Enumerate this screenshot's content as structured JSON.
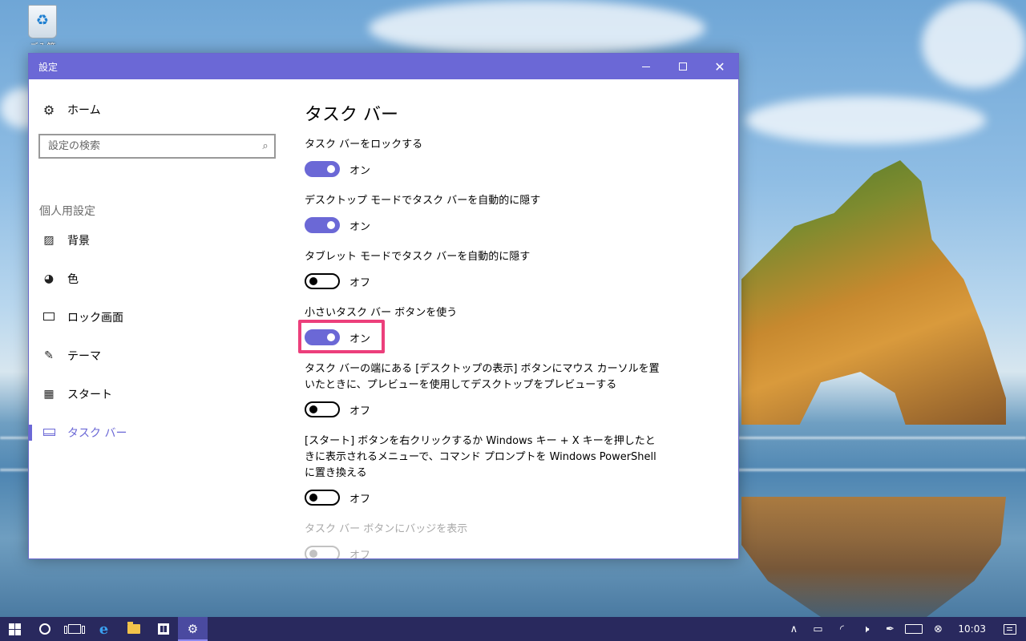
{
  "desktop": {
    "recycle_bin_label": "ごみ箱"
  },
  "window": {
    "title": "設定",
    "minimize_glyph": "—",
    "maximize_glyph": "☐",
    "close_glyph": "✕"
  },
  "sidebar": {
    "home_label": "ホーム",
    "home_icon": "gear-icon",
    "search_placeholder": "設定の検索",
    "section_heading": "個人用設定",
    "items": [
      {
        "label": "背景",
        "icon": "picture-icon",
        "selected": false
      },
      {
        "label": "色",
        "icon": "palette-icon",
        "selected": false
      },
      {
        "label": "ロック画面",
        "icon": "lock-screen-icon",
        "selected": false
      },
      {
        "label": "テーマ",
        "icon": "theme-icon",
        "selected": false
      },
      {
        "label": "スタート",
        "icon": "start-icon",
        "selected": false
      },
      {
        "label": "タスク バー",
        "icon": "taskbar-icon",
        "selected": true
      }
    ]
  },
  "main": {
    "title": "タスク バー",
    "settings": [
      {
        "label": "タスク バーをロックする",
        "state": "オン",
        "on": true,
        "enabled": true
      },
      {
        "label": "デスクトップ モードでタスク バーを自動的に隠す",
        "state": "オン",
        "on": true,
        "enabled": true
      },
      {
        "label": "タブレット モードでタスク バーを自動的に隠す",
        "state": "オフ",
        "on": false,
        "enabled": true
      },
      {
        "label": "小さいタスク バー ボタンを使う",
        "state": "オン",
        "on": true,
        "enabled": true,
        "highlighted": true
      },
      {
        "label": "タスク バーの端にある [デスクトップの表示] ボタンにマウス カーソルを置いたときに、プレビューを使用してデスクトップをプレビューする",
        "state": "オフ",
        "on": false,
        "enabled": true
      },
      {
        "label": "[スタート] ボタンを右クリックするか Windows キー + X キーを押したときに表示されるメニューで、コマンド プロンプトを Windows PowerShell に置き換える",
        "state": "オフ",
        "on": false,
        "enabled": true
      },
      {
        "label": "タスク バー ボタンにバッジを表示",
        "state": "オフ",
        "on": false,
        "enabled": false
      }
    ]
  },
  "taskbar": {
    "clock": "10:03",
    "colors": {
      "bar": "#29295e",
      "accent": "#6b68d6",
      "highlight": "#ec3f7b"
    }
  }
}
